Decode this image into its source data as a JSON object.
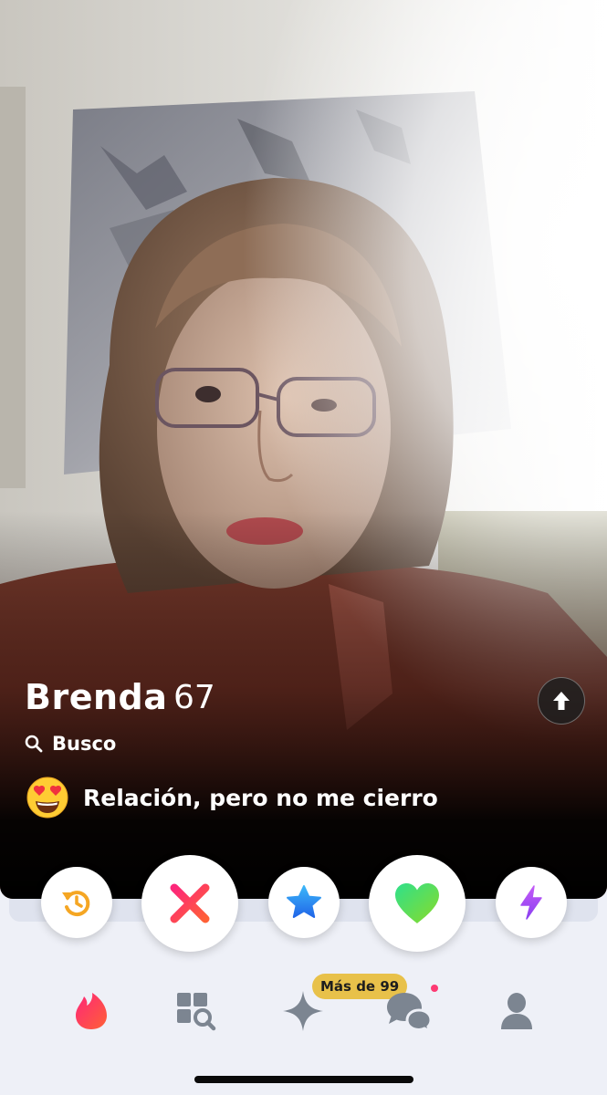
{
  "profile": {
    "name": "Brenda",
    "age": "67",
    "looking_for_label": "Busco",
    "relationship_goal": "Relación, pero no me cierro",
    "goal_emoji": "heart-eyes-emoji"
  },
  "actions": [
    {
      "name": "rewind-button",
      "icon": "rewind-icon",
      "color": "#f5a623"
    },
    {
      "name": "nope-button",
      "icon": "close-icon",
      "color": "#fd3a73"
    },
    {
      "name": "super-like-button",
      "icon": "star-icon",
      "color": "#2f8ff7"
    },
    {
      "name": "like-button",
      "icon": "heart-icon",
      "color": "#4cd964"
    },
    {
      "name": "boost-button",
      "icon": "lightning-icon",
      "color": "#b44ef5"
    }
  ],
  "tabbar": {
    "tabs": [
      {
        "name": "tab-swipe",
        "icon": "flame-icon",
        "active": true
      },
      {
        "name": "tab-explore",
        "icon": "explore-grid-icon",
        "active": false
      },
      {
        "name": "tab-likes",
        "icon": "sparkle-icon",
        "active": false
      },
      {
        "name": "tab-chat",
        "icon": "chat-bubbles-icon",
        "active": false
      },
      {
        "name": "tab-profile",
        "icon": "person-icon",
        "active": false
      }
    ],
    "likes_badge": "Más de 99",
    "brand_color": "#fd3a73",
    "inactive_color": "#7c8591"
  }
}
